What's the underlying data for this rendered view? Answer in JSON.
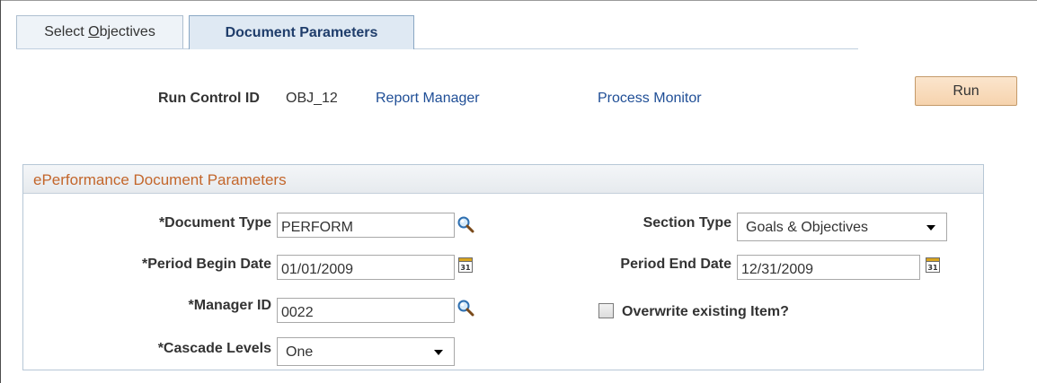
{
  "tabs": [
    {
      "label_pre": "Select ",
      "label_accel": "O",
      "label_post": "bjectives",
      "active": false
    },
    {
      "label": "Document Parameters",
      "active": true
    }
  ],
  "run_control": {
    "label": "Run Control ID",
    "value": "OBJ_12",
    "report_manager_link": "Report Manager",
    "process_monitor_link": "Process Monitor",
    "run_button": "Run"
  },
  "group": {
    "title": "ePerformance Document Parameters",
    "document_type": {
      "label": "*Document Type",
      "value": "PERFORM",
      "icon": "lookup-magnifier-icon"
    },
    "period_begin_date": {
      "label": "*Period Begin Date",
      "value": "01/01/2009",
      "icon": "calendar-icon"
    },
    "manager_id": {
      "label": "*Manager ID",
      "value": "0022",
      "icon": "lookup-magnifier-icon"
    },
    "cascade_levels": {
      "label": "*Cascade Levels",
      "value": "One"
    },
    "section_type": {
      "label": "Section Type",
      "value": "Goals & Objectives"
    },
    "period_end_date": {
      "label": "Period End Date",
      "value": "12/31/2009",
      "icon": "calendar-icon"
    },
    "overwrite": {
      "label": "Overwrite existing Item?",
      "checked": false
    }
  }
}
